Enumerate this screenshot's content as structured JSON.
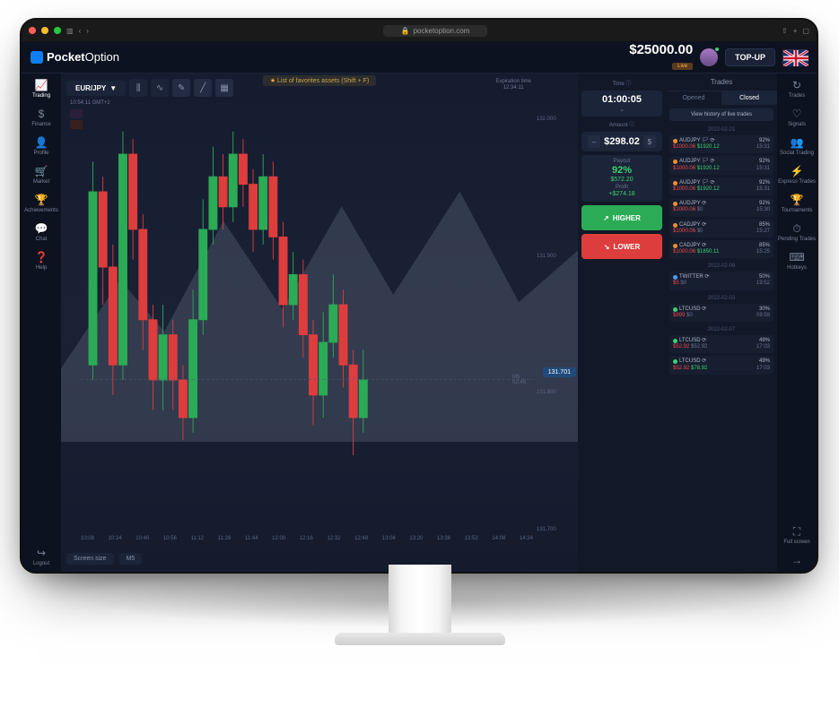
{
  "browser": {
    "url": "pocketoption.com"
  },
  "brand": {
    "name_a": "Pocket",
    "name_b": "Option"
  },
  "header": {
    "balance": "$25000.00",
    "balance_badge": "Live",
    "topup": "TOP-UP"
  },
  "left_rail": [
    {
      "icon": "📈",
      "label": "Trading",
      "active": true
    },
    {
      "icon": "$",
      "label": "Finance"
    },
    {
      "icon": "👤",
      "label": "Profile"
    },
    {
      "icon": "🛒",
      "label": "Market"
    },
    {
      "icon": "🏆",
      "label": "Achievements"
    },
    {
      "icon": "💬",
      "label": "Chat"
    },
    {
      "icon": "❓",
      "label": "Help"
    }
  ],
  "left_rail_bottom": {
    "icon": "↪",
    "label": "Logout"
  },
  "right_rail": [
    {
      "icon": "↻",
      "label": "Trades"
    },
    {
      "icon": "♡",
      "label": "Signals"
    },
    {
      "icon": "👥",
      "label": "Social Trading"
    },
    {
      "icon": "⚡",
      "label": "Express Trades"
    },
    {
      "icon": "🏆",
      "label": "Tournaments"
    },
    {
      "icon": "⏱",
      "label": "Pending Trades"
    },
    {
      "icon": "⌨",
      "label": "Hotkeys"
    }
  ],
  "right_rail_bottom": {
    "icon": "⛶",
    "label": "Full screen",
    "arrow": "→"
  },
  "chart": {
    "pair": "EUR/JPY",
    "tip": "List of favorites assets (Shift + F)",
    "tz": "10:54:11 GMT+2",
    "exp_label": "Expiration time",
    "exp_time": "12:34:11",
    "m5": "M5\n02:48",
    "price_tag": "131.701",
    "y_ticks": [
      "132.000",
      "131.900",
      "131.800",
      "131.700"
    ],
    "x_ticks": [
      "10:08",
      "10:24",
      "10:40",
      "10:56",
      "11:12",
      "11:28",
      "11:44",
      "12:00",
      "12:16",
      "12:32",
      "12:48",
      "13:04",
      "13:20",
      "13:36",
      "13:52",
      "14:08",
      "14:24"
    ],
    "screen_size": "Screen size",
    "timeframe": "M5"
  },
  "panel": {
    "time_label": "Time ⓘ",
    "time": "01:00:05",
    "amount_label": "Amount ⓘ",
    "amount": "$298.02",
    "switch": "$",
    "payout_label": "Payout",
    "payout_pct": "92%",
    "payout_val": "$572.20",
    "profit_label": "Profit",
    "profit_val": "+$274.18",
    "higher": "HIGHER",
    "lower": "LOWER"
  },
  "trades": {
    "title": "Trades",
    "tab_opened": "Opened",
    "tab_closed": "Closed",
    "history_btn": "View history of live trades",
    "groups": [
      {
        "date": "2022-02-21",
        "rows": [
          {
            "sym": "AUDJPY",
            "flag": true,
            "d": "o",
            "amt": "$1000.06",
            "ret": "$1920.12",
            "retc": "grn",
            "pct": "92%",
            "time": "15:31"
          },
          {
            "sym": "AUDJPY",
            "flag": true,
            "d": "o",
            "amt": "$1000.06",
            "ret": "$1920.12",
            "retc": "grn",
            "pct": "92%",
            "time": "15:31"
          },
          {
            "sym": "AUDJPY",
            "flag": true,
            "d": "o",
            "amt": "$1000.06",
            "ret": "$1920.12",
            "retc": "grn",
            "pct": "92%",
            "time": "15:31"
          },
          {
            "sym": "AUDJPY",
            "flag": false,
            "d": "o",
            "amt": "$1000.06",
            "ret": "$0",
            "retc": "gry",
            "pct": "92%",
            "time": "15:30"
          },
          {
            "sym": "CADJPY",
            "flag": false,
            "d": "o",
            "amt": "$1000.06",
            "ret": "$0",
            "retc": "gry",
            "pct": "85%",
            "time": "15:27"
          },
          {
            "sym": "CADJPY",
            "flag": false,
            "d": "o",
            "amt": "$1000.06",
            "ret": "$1850.11",
            "retc": "grn",
            "pct": "85%",
            "time": "15:25"
          }
        ]
      },
      {
        "date": "2022-02-09",
        "rows": [
          {
            "sym": "TWITTER",
            "flag": false,
            "d": "b",
            "amt": "$5",
            "ret": "$0",
            "retc": "gry",
            "pct": "50%",
            "time": "19:52"
          }
        ]
      },
      {
        "date": "2022-02-03",
        "rows": [
          {
            "sym": "LTCUSD",
            "flag": false,
            "d": "g",
            "amt": "$999",
            "ret": "$0",
            "retc": "gry",
            "pct": "30%",
            "time": "09:59"
          }
        ]
      },
      {
        "date": "2022-02-07",
        "rows": [
          {
            "sym": "LTCUSD",
            "flag": false,
            "d": "g",
            "amt": "$52.92",
            "ret": "$52.92",
            "retc": "gry",
            "pct": "49%",
            "time": "17:03"
          },
          {
            "sym": "LTCUSD",
            "flag": false,
            "d": "g",
            "amt": "$52.92",
            "ret": "$78.92",
            "retc": "grn",
            "pct": "49%",
            "time": "17:03"
          }
        ]
      }
    ]
  },
  "chart_data": {
    "type": "candlestick",
    "pair": "EUR/JPY",
    "ylim": [
      131.6,
      132.05
    ],
    "candles": [
      {
        "o": 131.72,
        "c": 131.95,
        "h": 131.99,
        "l": 131.7
      },
      {
        "o": 131.95,
        "c": 131.85,
        "h": 131.97,
        "l": 131.8
      },
      {
        "o": 131.85,
        "c": 131.72,
        "h": 131.88,
        "l": 131.68
      },
      {
        "o": 131.72,
        "c": 132.0,
        "h": 132.03,
        "l": 131.7
      },
      {
        "o": 132.0,
        "c": 131.9,
        "h": 132.02,
        "l": 131.86
      },
      {
        "o": 131.9,
        "c": 131.78,
        "h": 131.92,
        "l": 131.74
      },
      {
        "o": 131.78,
        "c": 131.7,
        "h": 131.8,
        "l": 131.66
      },
      {
        "o": 131.7,
        "c": 131.76,
        "h": 131.8,
        "l": 131.66
      },
      {
        "o": 131.76,
        "c": 131.7,
        "h": 131.78,
        "l": 131.66
      },
      {
        "o": 131.7,
        "c": 131.65,
        "h": 131.72,
        "l": 131.62
      },
      {
        "o": 131.65,
        "c": 131.78,
        "h": 131.82,
        "l": 131.63
      },
      {
        "o": 131.78,
        "c": 131.9,
        "h": 131.94,
        "l": 131.76
      },
      {
        "o": 131.9,
        "c": 131.97,
        "h": 132.01,
        "l": 131.88
      },
      {
        "o": 131.97,
        "c": 131.93,
        "h": 132.0,
        "l": 131.9
      },
      {
        "o": 131.93,
        "c": 132.0,
        "h": 132.03,
        "l": 131.91
      },
      {
        "o": 132.0,
        "c": 131.96,
        "h": 132.02,
        "l": 131.93
      },
      {
        "o": 131.96,
        "c": 131.9,
        "h": 131.98,
        "l": 131.87
      },
      {
        "o": 131.9,
        "c": 131.97,
        "h": 132.0,
        "l": 131.88
      },
      {
        "o": 131.97,
        "c": 131.89,
        "h": 131.99,
        "l": 131.86
      },
      {
        "o": 131.89,
        "c": 131.8,
        "h": 131.91,
        "l": 131.77
      },
      {
        "o": 131.8,
        "c": 131.84,
        "h": 131.87,
        "l": 131.78
      },
      {
        "o": 131.84,
        "c": 131.76,
        "h": 131.86,
        "l": 131.73
      },
      {
        "o": 131.76,
        "c": 131.68,
        "h": 131.78,
        "l": 131.64
      },
      {
        "o": 131.68,
        "c": 131.75,
        "h": 131.79,
        "l": 131.65
      },
      {
        "o": 131.75,
        "c": 131.8,
        "h": 131.84,
        "l": 131.73
      },
      {
        "o": 131.8,
        "c": 131.72,
        "h": 131.82,
        "l": 131.69
      },
      {
        "o": 131.72,
        "c": 131.65,
        "h": 131.74,
        "l": 131.6
      },
      {
        "o": 131.65,
        "c": 131.7,
        "h": 131.74,
        "l": 131.63
      }
    ]
  }
}
